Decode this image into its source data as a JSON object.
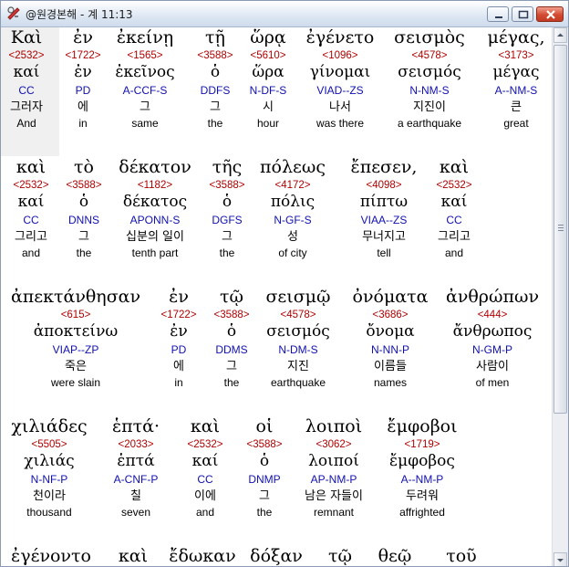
{
  "window": {
    "title": "@원경본해 - 계 11:13"
  },
  "rows": [
    {
      "words": [
        {
          "greek": "Καὶ",
          "strong": "<2532>",
          "lexeme": "καί",
          "parse": "CC",
          "korean": "그러자",
          "english": "And"
        },
        {
          "greek": "ἐν",
          "strong": "<1722>",
          "lexeme": "ἐν",
          "parse": "PD",
          "korean": "에",
          "english": "in"
        },
        {
          "greek": "ἐκείνῃ",
          "strong": "<1565>",
          "lexeme": "ἐκεῖνος",
          "parse": "A-CCF-S",
          "korean": "그",
          "english": "same"
        },
        {
          "greek": "τῇ",
          "strong": "<3588>",
          "lexeme": "ὁ",
          "parse": "DDFS",
          "korean": "그",
          "english": "the"
        },
        {
          "greek": "ὥρᾳ",
          "strong": "<5610>",
          "lexeme": "ὥρα",
          "parse": "N-DF-S",
          "korean": "시",
          "english": "hour"
        },
        {
          "greek": "ἐγένετο",
          "strong": "<1096>",
          "lexeme": "γίνομαι",
          "parse": "VIAD--ZS",
          "korean": "나서",
          "english": "was there"
        },
        {
          "greek": "σεισμὸς",
          "strong": "<4578>",
          "lexeme": "σεισμός",
          "parse": "N-NM-S",
          "korean": "지진이",
          "english": "a earthquake"
        },
        {
          "greek": "μέγας,",
          "strong": "<3173>",
          "lexeme": "μέγας",
          "parse": "A--NM-S",
          "korean": "큰",
          "english": "great"
        }
      ]
    },
    {
      "words": [
        {
          "greek": "καὶ",
          "strong": "<2532>",
          "lexeme": "καί",
          "parse": "CC",
          "korean": "그리고",
          "english": "and"
        },
        {
          "greek": "τὸ",
          "strong": "<3588>",
          "lexeme": "ὁ",
          "parse": "DNNS",
          "korean": "그",
          "english": "the"
        },
        {
          "greek": "δέκατον",
          "strong": "<1182>",
          "lexeme": "δέκατος",
          "parse": "APONN-S",
          "korean": "십분의 일이",
          "english": "tenth part"
        },
        {
          "greek": "τῆς",
          "strong": "<3588>",
          "lexeme": "ὁ",
          "parse": "DGFS",
          "korean": "그",
          "english": "the"
        },
        {
          "greek": "πόλεως",
          "strong": "<4172>",
          "lexeme": "πόλις",
          "parse": "N-GF-S",
          "korean": "성",
          "english": "of city"
        },
        {
          "greek": "ἔπεσεν,",
          "strong": "<4098>",
          "lexeme": "πίπτω",
          "parse": "VIAA--ZS",
          "korean": "무너지고",
          "english": "tell"
        },
        {
          "greek": "καὶ",
          "strong": "<2532>",
          "lexeme": "καί",
          "parse": "CC",
          "korean": "그리고",
          "english": "and"
        }
      ]
    },
    {
      "words": [
        {
          "greek": "ἀπεκτάνθησαν",
          "strong": "<615>",
          "lexeme": "ἀποκτείνω",
          "parse": "VIAP--ZP",
          "korean": "죽은",
          "english": "were slain"
        },
        {
          "greek": "ἐν",
          "strong": "<1722>",
          "lexeme": "ἐν",
          "parse": "PD",
          "korean": "에",
          "english": "in"
        },
        {
          "greek": "τῷ",
          "strong": "<3588>",
          "lexeme": "ὁ",
          "parse": "DDMS",
          "korean": "그",
          "english": "the"
        },
        {
          "greek": "σεισμῷ",
          "strong": "<4578>",
          "lexeme": "σεισμός",
          "parse": "N-DM-S",
          "korean": "지진",
          "english": "earthquake"
        },
        {
          "greek": "ὀνόματα",
          "strong": "<3686>",
          "lexeme": "ὄνομα",
          "parse": "N-NN-P",
          "korean": "이름들",
          "english": "names"
        },
        {
          "greek": "ἀνθρώπων",
          "strong": "<444>",
          "lexeme": "ἄνθρωπος",
          "parse": "N-GM-P",
          "korean": "사람이",
          "english": "of men"
        }
      ]
    },
    {
      "words": [
        {
          "greek": "χιλιάδες",
          "strong": "<5505>",
          "lexeme": "χιλιάς",
          "parse": "N-NF-P",
          "korean": "천이라",
          "english": "thousand"
        },
        {
          "greek": "ἑπτά·",
          "strong": "<2033>",
          "lexeme": "ἑπτά",
          "parse": "A-CNF-P",
          "korean": "칠",
          "english": "seven"
        },
        {
          "greek": "καὶ",
          "strong": "<2532>",
          "lexeme": "καί",
          "parse": "CC",
          "korean": "이에",
          "english": "and"
        },
        {
          "greek": "οἱ",
          "strong": "<3588>",
          "lexeme": "ὁ",
          "parse": "DNMP",
          "korean": "그",
          "english": "the"
        },
        {
          "greek": "λοιποὶ",
          "strong": "<3062>",
          "lexeme": "λοιποί",
          "parse": "AP-NM-P",
          "korean": "남은 자들이",
          "english": "remnant"
        },
        {
          "greek": "ἔμφοβοι",
          "strong": "<1719>",
          "lexeme": "ἔμφοβος",
          "parse": "A--NM-P",
          "korean": "두려워",
          "english": "affrighted"
        }
      ]
    },
    {
      "words": [
        {
          "greek": "ἐγένοντο"
        },
        {
          "greek": "καὶ"
        },
        {
          "greek": "ἔδωκαν"
        },
        {
          "greek": "δόξαν"
        },
        {
          "greek": "τῷ"
        },
        {
          "greek": "θεῷ"
        },
        {
          "greek": "τοῦ"
        }
      ]
    }
  ]
}
